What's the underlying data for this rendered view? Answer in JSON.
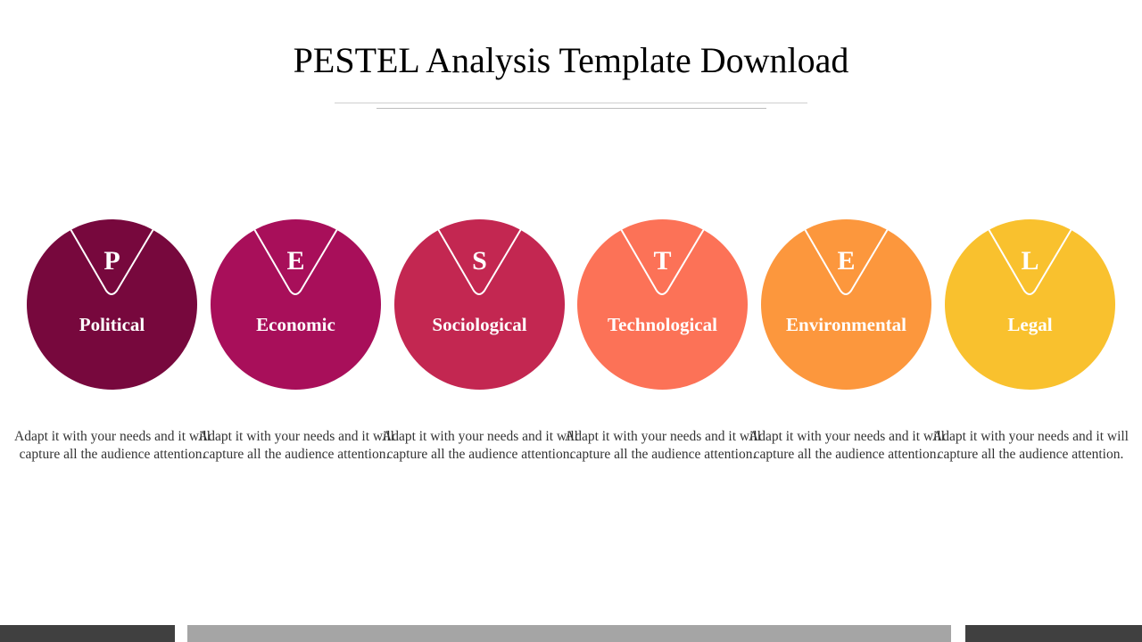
{
  "title": "PESTEL Analysis Template Download",
  "items": [
    {
      "letter": "P",
      "label": "Political",
      "color": "#77083d",
      "description": "Adapt it with your needs and it will capture all the audience attention."
    },
    {
      "letter": "E",
      "label": "Economic",
      "color": "#a80f5a",
      "description": "Adapt it with your needs and it will capture all the audience attention."
    },
    {
      "letter": "S",
      "label": "Sociological",
      "color": "#c32751",
      "description": "Adapt it with your needs and it will capture all the audience attention."
    },
    {
      "letter": "T",
      "label": "Technological",
      "color": "#fc7257",
      "description": "Adapt it with your needs and it will capture all the audience attention."
    },
    {
      "letter": "E",
      "label": "Environmental",
      "color": "#fc973d",
      "description": "Adapt it with your needs and it will capture all the audience attention."
    },
    {
      "letter": "L",
      "label": "Legal",
      "color": "#f9c12e",
      "description": "Adapt it with your needs and it will capture all the audience attention."
    }
  ],
  "footer": {
    "left_color": "#404040",
    "mid_color": "#a5a5a5",
    "right_color": "#404040"
  }
}
